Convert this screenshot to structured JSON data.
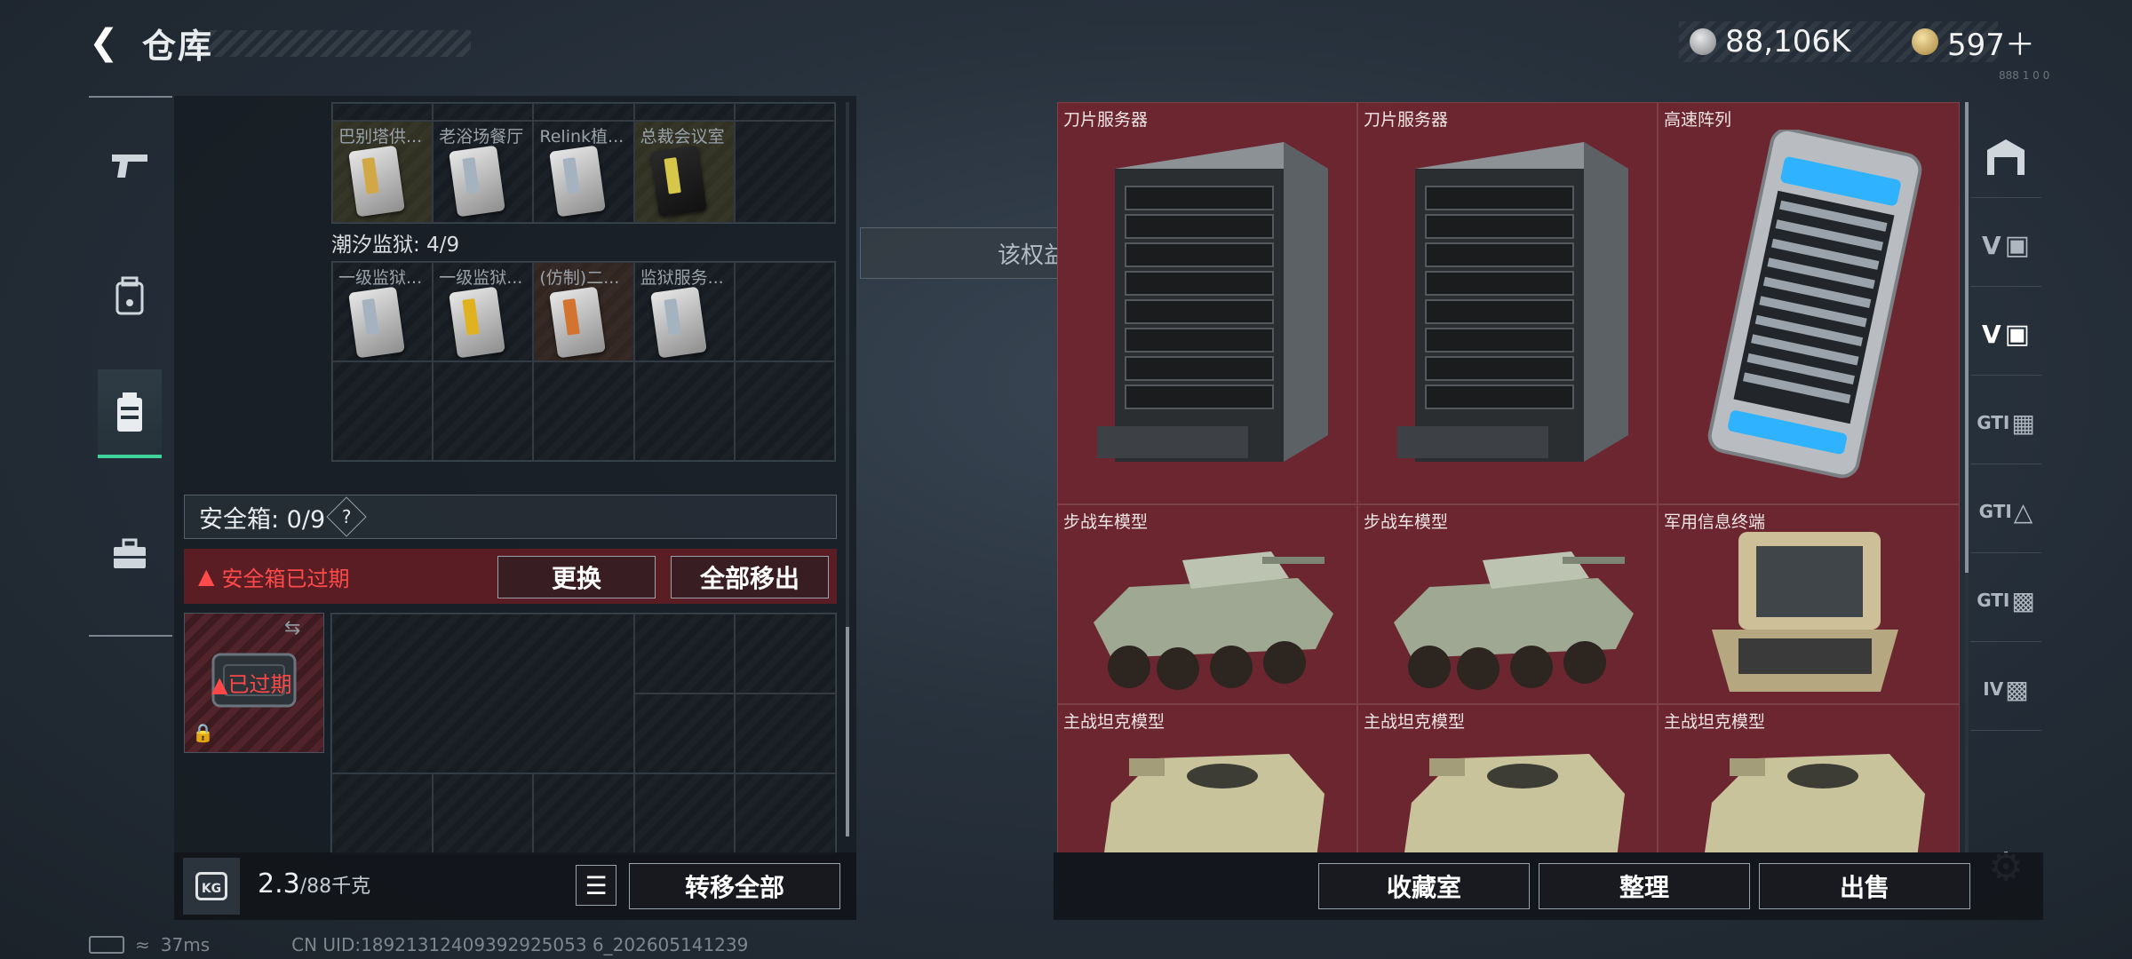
{
  "header": {
    "title": "仓库"
  },
  "currency": {
    "silver": "88,106K",
    "gold": "597＋",
    "tiny": "888 1 0 0"
  },
  "left_rail": {
    "items": [
      "weapon",
      "backpack",
      "vest",
      "toolbox"
    ]
  },
  "storage_top": {
    "row_labels": [
      "巴别塔供...",
      "老浴场餐厅",
      "Relink植...",
      "总裁会议室",
      ""
    ]
  },
  "section": {
    "label": "潮汐监狱: 4/9"
  },
  "prison": {
    "labels": [
      "一级监狱...",
      "一级监狱...",
      "(仿制)二...",
      "监狱服务...",
      ""
    ]
  },
  "safe": {
    "label": "安全箱: 0/9",
    "help": "?",
    "expired_warning": "安全箱已过期",
    "replace_button": "更换",
    "move_all_out_button": "全部移出",
    "slot_status": "已过期"
  },
  "weight": {
    "current": "2.3",
    "max": "/88千克"
  },
  "bottom_left": {
    "transfer_all": "转移全部",
    "kg_badge": "KG"
  },
  "tooltip": "该权益已过期",
  "grid_items": [
    {
      "label": "刀片服务器",
      "kind": "server"
    },
    {
      "label": "刀片服务器",
      "kind": "server"
    },
    {
      "label": "高速阵列",
      "kind": "array"
    },
    {
      "label": "步战车模型",
      "kind": "ifv"
    },
    {
      "label": "步战车模型",
      "kind": "ifv"
    },
    {
      "label": "军用信息终端",
      "kind": "terminal"
    },
    {
      "label": "主战坦克模型",
      "kind": "tank"
    },
    {
      "label": "主战坦克模型",
      "kind": "tank"
    },
    {
      "label": "主战坦克模型",
      "kind": "tank"
    }
  ],
  "side_tabs": [
    "",
    "V",
    "V",
    "GTI",
    "GTI",
    "GTI",
    "IV"
  ],
  "bottom_right": {
    "collection": "收藏室",
    "organize": "整理",
    "sell": "出售"
  },
  "status": {
    "ping": "37ms",
    "uid": "CN UID:18921312409392925053 6_202605141239"
  }
}
